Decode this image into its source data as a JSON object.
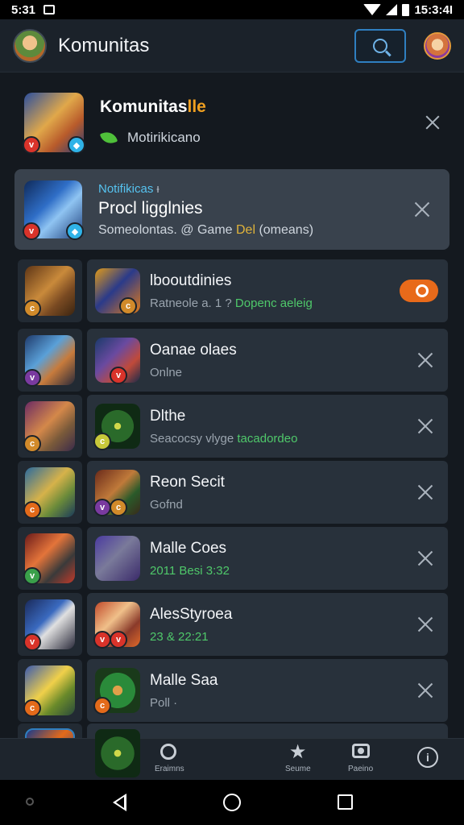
{
  "status_bar": {
    "time": "5:31",
    "right_time": "15:3:4I"
  },
  "app_bar": {
    "title": "Komunitas"
  },
  "header": {
    "title": "Komunitas",
    "title_accent": "lle",
    "subtitle": "Motirikicano"
  },
  "notification": {
    "label": "Notifikicas",
    "pin": "ᵻ",
    "title": "Procl ligglnies",
    "sub_prefix": "Someolontas. @ Game ",
    "sub_gold": "Del",
    "sub_suffix": " (omeans)"
  },
  "list": [
    {
      "title": "lbooutdinies",
      "sub_a": "Ratneole a. 1 ? ",
      "sub_b": "Dopenc aeleig",
      "trailing": "toggle"
    },
    {
      "title": "Oanae olaes",
      "sub": "Onlne",
      "sub_color": "gray",
      "trailing": "close"
    },
    {
      "title": "Dlthe",
      "sub_a": "Seacocsy vlyge ",
      "sub_b": "tacadordeo",
      "trailing": "close"
    },
    {
      "title": "Reon Secit",
      "sub": "Gofnd",
      "sub_color": "gray",
      "trailing": "close"
    },
    {
      "title": "Malle Coes",
      "sub": "2011 Besi 3:32",
      "sub_color": "green",
      "trailing": "close"
    },
    {
      "title": "AlesStyroea",
      "sub": "23 & 22:21",
      "sub_color": "green",
      "trailing": "close"
    },
    {
      "title": "Malle Saa",
      "sub": "Poll ·",
      "sub_color": "gray",
      "trailing": "close"
    }
  ],
  "bottom_nav": [
    {
      "label": "Eraimns",
      "icon": "ring-icon"
    },
    {
      "label": "Seume",
      "icon": "star-icon"
    },
    {
      "label": "Paeino",
      "icon": "camera-icon"
    },
    {
      "label": "",
      "icon": "info-icon"
    }
  ],
  "colors": {
    "accent_blue": "#2f7fc0",
    "toggle_orange": "#e86a1a",
    "online_green": "#4fc86a"
  }
}
